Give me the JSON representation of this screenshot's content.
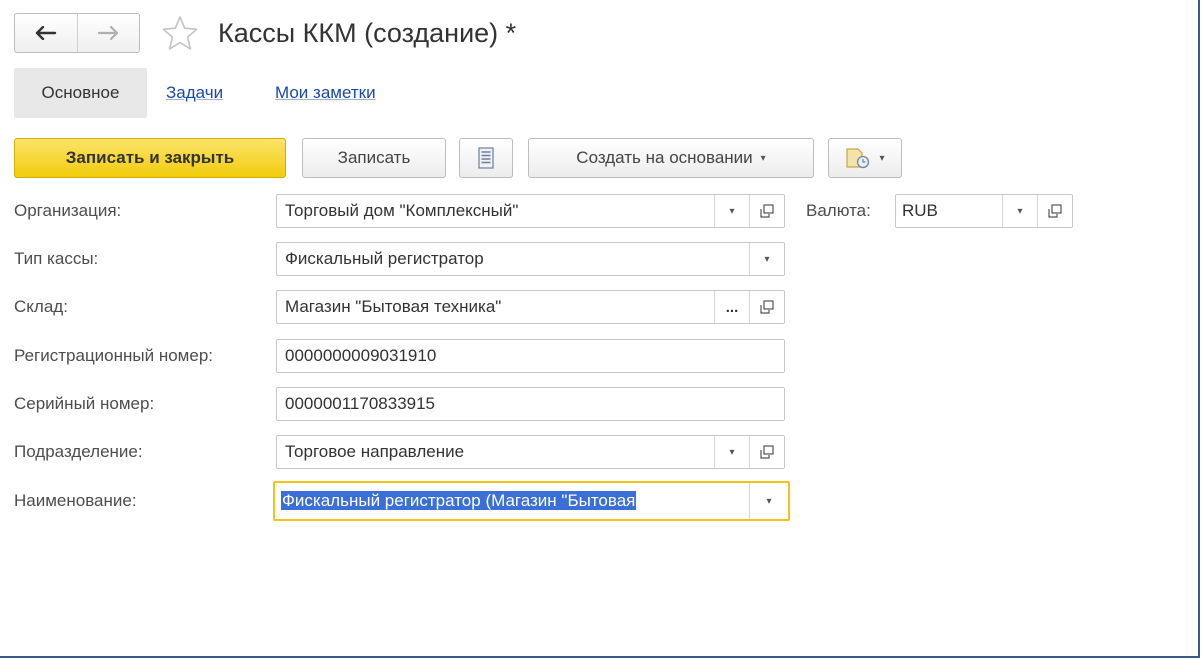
{
  "window": {
    "title": "Кассы ККМ (создание) *"
  },
  "nav": {
    "back_icon": "arrow-left-icon",
    "forward_icon": "arrow-right-icon",
    "favorite_icon": "star-icon"
  },
  "tabs": [
    {
      "label": "Основное",
      "active": true
    },
    {
      "label": "Задачи",
      "active": false
    },
    {
      "label": "Мои заметки",
      "active": false
    }
  ],
  "toolbar": {
    "save_close_label": "Записать и закрыть",
    "save_label": "Записать",
    "report_icon": "document-list-icon",
    "create_based_label": "Создать на основании",
    "attach_icon": "attach-files-icon",
    "dropdown_caret": "▾"
  },
  "form": {
    "organization": {
      "label": "Организация:",
      "value": "Торговый дом \"Комплексный\""
    },
    "currency": {
      "label": "Валюта:",
      "value": "RUB"
    },
    "cash_type": {
      "label": "Тип кассы:",
      "value": "Фискальный регистратор"
    },
    "warehouse": {
      "label": "Склад:",
      "value": "Магазин \"Бытовая техника\"",
      "choose_label": "..."
    },
    "reg_number": {
      "label": "Регистрационный номер:",
      "value": "0000000009031910"
    },
    "serial_number": {
      "label": "Серийный номер:",
      "value": "0000001170833915"
    },
    "department": {
      "label": "Подразделение:",
      "value": "Торговое направление"
    },
    "name": {
      "label": "Наименование:",
      "value": "Фискальный регистратор (Магазин \"Бытовая"
    }
  },
  "colors": {
    "accent_button": "#f2cc0c",
    "link": "#1a4aa6",
    "focus_border": "#f0c419",
    "selection": "#3a6fd8"
  }
}
